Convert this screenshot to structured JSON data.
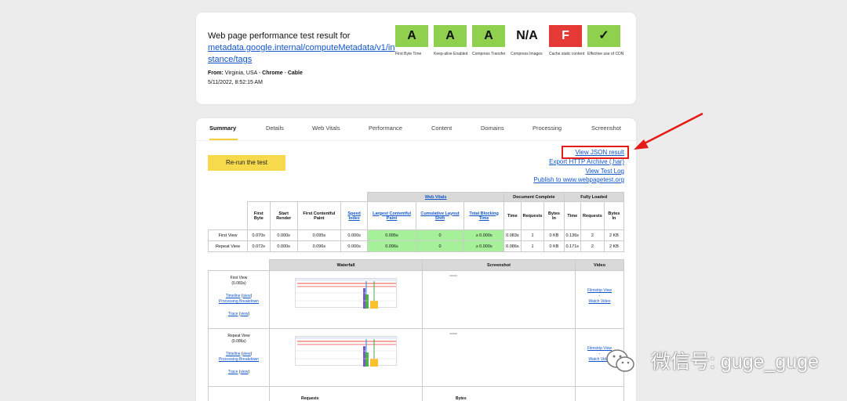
{
  "header": {
    "title": "Web page performance test result for",
    "url": "metadata.google.internal/computeMetadata/v1/instance/tags",
    "from_label": "From:",
    "from_text": "Virginia, USA - ",
    "browser": "Chrome",
    "sep": " - ",
    "connection": "Cable",
    "date": "5/11/2022, 8:52:15 AM"
  },
  "grades": [
    {
      "value": "A",
      "label": "First Byte Time",
      "color": "#8fd14f"
    },
    {
      "value": "A",
      "label": "Keep-alive Enabled",
      "color": "#8fd14f"
    },
    {
      "value": "A",
      "label": "Compress Transfer",
      "color": "#8fd14f"
    },
    {
      "value": "N/A",
      "label": "Compress Images",
      "color": "#ffffff"
    },
    {
      "value": "F",
      "label": "Cache static content",
      "color": "#e53935"
    },
    {
      "value": "✓",
      "label": "Effective use of CDN",
      "color": "#8fd14f"
    }
  ],
  "tabs": [
    "Summary",
    "Details",
    "Web Vitals",
    "Performance",
    "Content",
    "Domains",
    "Processing",
    "Screenshot"
  ],
  "actions": {
    "rerun": "Re-run the test",
    "json": "View JSON result",
    "har": "Export HTTP Archive (.har)",
    "log": "View Test Log",
    "publish": "Publish to www.webpagetest.org"
  },
  "results": {
    "group_web_vitals": "Web Vitals",
    "group_doc": "Document Complete",
    "group_full": "Fully Loaded",
    "cols": [
      "First Byte",
      "Start Render",
      "First Contentful Paint",
      "Speed Index",
      "Largest Contentful Paint",
      "Cumulative Layout Shift",
      "Total Blocking Time",
      "Time",
      "Requests",
      "Bytes In",
      "Time",
      "Requests",
      "Bytes In"
    ],
    "rows": [
      {
        "label": "First View",
        "cells": [
          "0.070s",
          "0.000s",
          "0.095s",
          "0.000s",
          "0.095s",
          "0",
          "≥ 0.000s",
          "0.083s",
          "1",
          "0 KB",
          "0.136s",
          "2",
          "2 KB"
        ]
      },
      {
        "label": "Repeat View",
        "cells": [
          "0.072s",
          "0.000s",
          "0.096s",
          "0.000s",
          "0.096s",
          "0",
          "≥ 0.000s",
          "0.086s",
          "1",
          "0 KB",
          "0.171s",
          "2",
          "2 KB"
        ]
      }
    ]
  },
  "views": {
    "headers": [
      "Waterfall",
      "Screenshot",
      "Video"
    ],
    "rows": [
      {
        "title": "First View",
        "time": "(0.083s)",
        "timeline": "Timeline",
        "view": "view",
        "processing": "Processing Breakdown",
        "trace": "Trace",
        "video1": "Filmstrip View",
        "dash": "-",
        "video2": "Watch Video"
      },
      {
        "title": "Repeat View",
        "time": "(0.086s)",
        "timeline": "Timeline",
        "view": "view",
        "processing": "Processing Breakdown",
        "trace": "Trace",
        "video1": "Filmstrip View",
        "dash": "-",
        "video2": "Watch Video"
      }
    ],
    "bottom": [
      "Requests",
      "Bytes"
    ]
  },
  "watermark": "微信号: guge_guge",
  "colors": {
    "accent": "#f7d94c",
    "highlight": "#e41b17",
    "green_cell": "#a6f09a"
  }
}
